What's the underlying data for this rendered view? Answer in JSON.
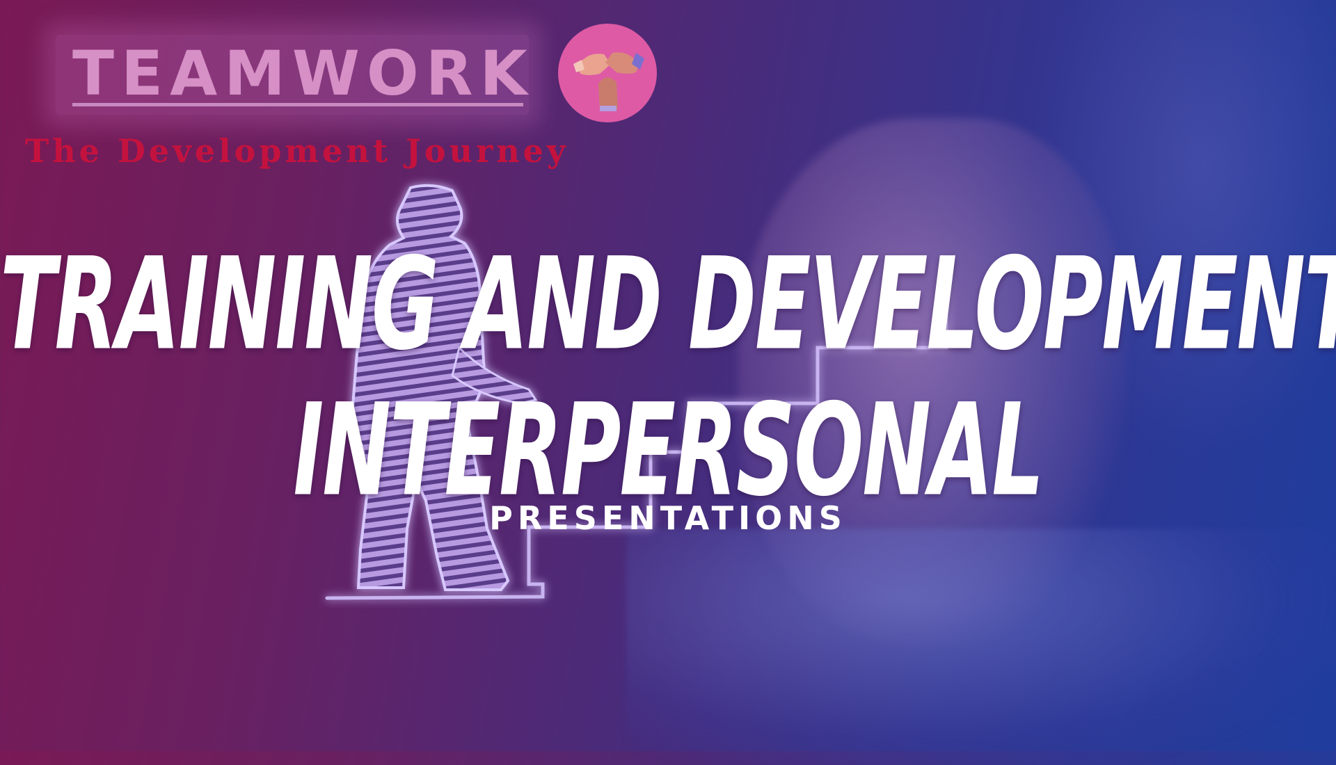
{
  "logo": {
    "word": "TEAMWORK",
    "icon": "joined-hands-icon",
    "tagline": "The Development Journey"
  },
  "headline": {
    "line1": "TRAINING AND DEVELOPMENT",
    "line2": "INTERPERSONAL"
  },
  "subtitle": "PRESENTATIONS",
  "colors": {
    "background_start": "#7a1a55",
    "background_end": "#1f3d9e",
    "logo_text": "#d690c6",
    "tagline": "#c4123e",
    "logo_circle": "#de5aa5",
    "headline": "#ffffff"
  }
}
